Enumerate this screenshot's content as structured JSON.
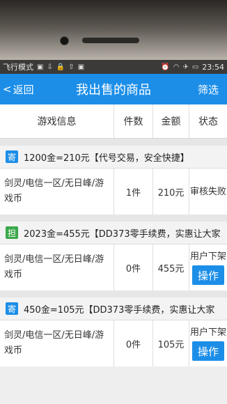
{
  "statusbar": {
    "left_text": "飞行模式",
    "time": "23:54"
  },
  "header": {
    "back_label": "返回",
    "title": "我出售的商品",
    "filter_label": "筛选"
  },
  "table": {
    "columns": [
      "游戏信息",
      "件数",
      "金额",
      "状态"
    ]
  },
  "groups": [
    {
      "badge": "寄",
      "badge_color": "#1c8ee8",
      "summary": "1200金=210元【代号交易，安全快捷】",
      "game": "剑灵/电信一区/无日峰/游戏币",
      "quantity": "1件",
      "amount": "210元",
      "status": "审核失败",
      "action": ""
    },
    {
      "badge": "担",
      "badge_color": "#3aa84a",
      "summary": "2023金=455元【DD373零手续费，实惠让大家",
      "game": "剑灵/电信一区/无日峰/游戏币",
      "quantity": "0件",
      "amount": "455元",
      "status": "用户下架",
      "action": "操作"
    },
    {
      "badge": "寄",
      "badge_color": "#1c8ee8",
      "summary": "450金=105元【DD373零手续费，实惠让大家",
      "game": "剑灵/电信一区/无日峰/游戏币",
      "quantity": "0件",
      "amount": "105元",
      "status": "用户下架",
      "action": "操作"
    }
  ]
}
